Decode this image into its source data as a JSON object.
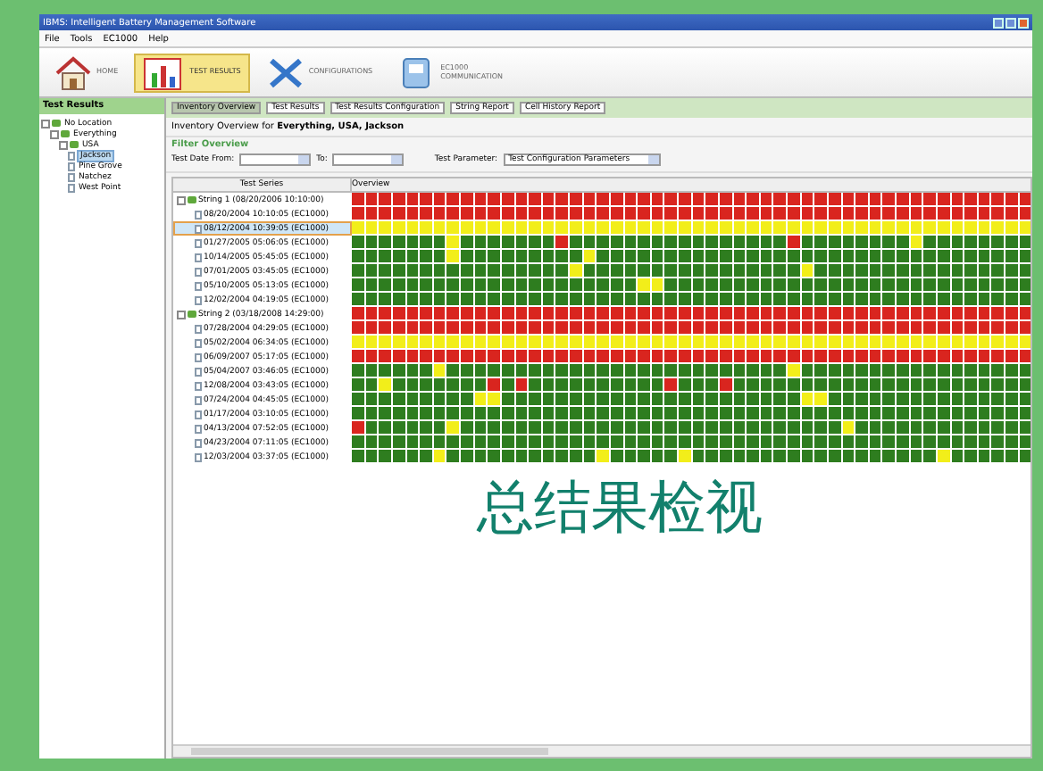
{
  "window": {
    "title": "IBMS: Intelligent Battery Management Software"
  },
  "menu": [
    "File",
    "Tools",
    "EC1000",
    "Help"
  ],
  "toolbar": [
    {
      "label": "HOME",
      "kind": "home",
      "selected": false
    },
    {
      "label": "TEST RESULTS",
      "kind": "results",
      "selected": true
    },
    {
      "label": "CONFIGURATIONS",
      "kind": "config",
      "selected": false
    },
    {
      "label": "EC1000 COMMUNICATION",
      "kind": "comm",
      "selected": false
    }
  ],
  "sidebar": {
    "title": "Test Results",
    "tree": [
      {
        "label": "No Location",
        "children": [
          {
            "label": "Everything",
            "children": [
              {
                "label": "USA",
                "children": [
                  {
                    "label": "Jackson",
                    "selected": true
                  },
                  {
                    "label": "Pine Grove",
                    "selected": false
                  },
                  {
                    "label": "Natchez",
                    "selected": false
                  },
                  {
                    "label": "West Point",
                    "selected": false
                  }
                ]
              }
            ]
          }
        ]
      }
    ]
  },
  "tabs": [
    {
      "label": "Inventory Overview",
      "selected": true
    },
    {
      "label": "Test Results",
      "selected": false
    },
    {
      "label": "Test Results Configuration",
      "selected": false
    },
    {
      "label": "String Report",
      "selected": false
    },
    {
      "label": "Cell History Report",
      "selected": false
    }
  ],
  "heading": "Inventory Overview for **Everything, USA, Jackson**",
  "filter": {
    "title": "Filter Overview",
    "date_from_label": "Test Date From:",
    "to_label": "To:",
    "parameter_label": "Test Parameter:",
    "parameter_value": "Test Configuration Parameters"
  },
  "table": {
    "columns": [
      "Test Series",
      "Overview"
    ],
    "groups": [
      {
        "label": "String 1 (08/20/2006 10:10:00)",
        "color": "#d9251f",
        "rows": [
          {
            "label": "08/20/2004 10:10:05 (EC1000)",
            "selected": false,
            "color": "#d9251f"
          },
          {
            "label": "08/12/2004 10:39:05 (EC1000)",
            "selected": true,
            "color": "#f2ee1a"
          },
          {
            "label": "01/27/2005 05:06:05 (EC1000)",
            "selected": false,
            "cells": [
              {
                "color": "#2e7d1f"
              },
              {
                "color": "#2e7d1f"
              },
              {
                "color": "#2e7d1f"
              },
              {
                "color": "#2e7d1f"
              },
              {
                "color": "#2e7d1f"
              },
              {
                "color": "#2e7d1f"
              },
              {
                "color": "#2e7d1f"
              },
              {
                "color": "#f2ee1a"
              },
              {
                "color": "#2e7d1f"
              },
              {
                "color": "#2e7d1f"
              },
              {
                "color": "#2e7d1f"
              },
              {
                "color": "#2e7d1f"
              },
              {
                "color": "#2e7d1f"
              },
              {
                "color": "#2e7d1f"
              },
              {
                "color": "#2e7d1f"
              },
              {
                "color": "#d9251f"
              },
              {
                "color": "#2e7d1f"
              },
              {
                "color": "#2e7d1f"
              },
              {
                "color": "#2e7d1f"
              },
              {
                "color": "#2e7d1f"
              },
              {
                "color": "#2e7d1f"
              },
              {
                "color": "#2e7d1f"
              },
              {
                "color": "#2e7d1f"
              },
              {
                "color": "#2e7d1f"
              },
              {
                "color": "#2e7d1f"
              },
              {
                "color": "#2e7d1f"
              },
              {
                "color": "#2e7d1f"
              },
              {
                "color": "#2e7d1f"
              },
              {
                "color": "#2e7d1f"
              },
              {
                "color": "#2e7d1f"
              },
              {
                "color": "#2e7d1f"
              },
              {
                "color": "#2e7d1f"
              },
              {
                "color": "#d9251f"
              },
              {
                "color": "#2e7d1f"
              },
              {
                "color": "#2e7d1f"
              },
              {
                "color": "#2e7d1f"
              },
              {
                "color": "#2e7d1f"
              },
              {
                "color": "#2e7d1f"
              },
              {
                "color": "#2e7d1f"
              },
              {
                "color": "#2e7d1f"
              },
              {
                "color": "#2e7d1f"
              },
              {
                "color": "#f2ee1a"
              },
              {
                "color": "#2e7d1f"
              },
              {
                "color": "#2e7d1f"
              },
              {
                "color": "#2e7d1f"
              },
              {
                "color": "#2e7d1f"
              },
              {
                "color": "#2e7d1f"
              },
              {
                "color": "#2e7d1f"
              },
              {
                "color": "#2e7d1f"
              },
              {
                "color": "#2e7d1f"
              }
            ]
          },
          {
            "label": "10/14/2005 05:45:05 (EC1000)",
            "selected": false,
            "cells": [
              {
                "color": "#2e7d1f"
              },
              {
                "color": "#2e7d1f"
              },
              {
                "color": "#2e7d1f"
              },
              {
                "color": "#2e7d1f"
              },
              {
                "color": "#2e7d1f"
              },
              {
                "color": "#2e7d1f"
              },
              {
                "color": "#2e7d1f"
              },
              {
                "color": "#f2ee1a"
              },
              {
                "color": "#2e7d1f"
              },
              {
                "color": "#2e7d1f"
              },
              {
                "color": "#2e7d1f"
              },
              {
                "color": "#2e7d1f"
              },
              {
                "color": "#2e7d1f"
              },
              {
                "color": "#2e7d1f"
              },
              {
                "color": "#2e7d1f"
              },
              {
                "color": "#2e7d1f"
              },
              {
                "color": "#2e7d1f"
              },
              {
                "color": "#f2ee1a"
              },
              {
                "color": "#2e7d1f"
              },
              {
                "color": "#2e7d1f"
              },
              {
                "color": "#2e7d1f"
              },
              {
                "color": "#2e7d1f"
              },
              {
                "color": "#2e7d1f"
              },
              {
                "color": "#2e7d1f"
              },
              {
                "color": "#2e7d1f"
              },
              {
                "color": "#2e7d1f"
              },
              {
                "color": "#2e7d1f"
              },
              {
                "color": "#2e7d1f"
              },
              {
                "color": "#2e7d1f"
              },
              {
                "color": "#2e7d1f"
              },
              {
                "color": "#2e7d1f"
              },
              {
                "color": "#2e7d1f"
              },
              {
                "color": "#2e7d1f"
              },
              {
                "color": "#2e7d1f"
              },
              {
                "color": "#2e7d1f"
              },
              {
                "color": "#2e7d1f"
              },
              {
                "color": "#2e7d1f"
              },
              {
                "color": "#2e7d1f"
              },
              {
                "color": "#2e7d1f"
              },
              {
                "color": "#2e7d1f"
              },
              {
                "color": "#2e7d1f"
              },
              {
                "color": "#2e7d1f"
              },
              {
                "color": "#2e7d1f"
              },
              {
                "color": "#2e7d1f"
              },
              {
                "color": "#2e7d1f"
              },
              {
                "color": "#2e7d1f"
              },
              {
                "color": "#2e7d1f"
              },
              {
                "color": "#2e7d1f"
              },
              {
                "color": "#2e7d1f"
              },
              {
                "color": "#2e7d1f"
              }
            ]
          },
          {
            "label": "07/01/2005 03:45:05 (EC1000)",
            "selected": false,
            "cells": [
              {
                "color": "#2e7d1f"
              },
              {
                "color": "#2e7d1f"
              },
              {
                "color": "#2e7d1f"
              },
              {
                "color": "#2e7d1f"
              },
              {
                "color": "#2e7d1f"
              },
              {
                "color": "#2e7d1f"
              },
              {
                "color": "#2e7d1f"
              },
              {
                "color": "#2e7d1f"
              },
              {
                "color": "#2e7d1f"
              },
              {
                "color": "#2e7d1f"
              },
              {
                "color": "#2e7d1f"
              },
              {
                "color": "#2e7d1f"
              },
              {
                "color": "#2e7d1f"
              },
              {
                "color": "#2e7d1f"
              },
              {
                "color": "#2e7d1f"
              },
              {
                "color": "#2e7d1f"
              },
              {
                "color": "#f2ee1a"
              },
              {
                "color": "#2e7d1f"
              },
              {
                "color": "#2e7d1f"
              },
              {
                "color": "#2e7d1f"
              },
              {
                "color": "#2e7d1f"
              },
              {
                "color": "#2e7d1f"
              },
              {
                "color": "#2e7d1f"
              },
              {
                "color": "#2e7d1f"
              },
              {
                "color": "#2e7d1f"
              },
              {
                "color": "#2e7d1f"
              },
              {
                "color": "#2e7d1f"
              },
              {
                "color": "#2e7d1f"
              },
              {
                "color": "#2e7d1f"
              },
              {
                "color": "#2e7d1f"
              },
              {
                "color": "#2e7d1f"
              },
              {
                "color": "#2e7d1f"
              },
              {
                "color": "#2e7d1f"
              },
              {
                "color": "#f2ee1a"
              },
              {
                "color": "#2e7d1f"
              },
              {
                "color": "#2e7d1f"
              },
              {
                "color": "#2e7d1f"
              },
              {
                "color": "#2e7d1f"
              },
              {
                "color": "#2e7d1f"
              },
              {
                "color": "#2e7d1f"
              },
              {
                "color": "#2e7d1f"
              },
              {
                "color": "#2e7d1f"
              },
              {
                "color": "#2e7d1f"
              },
              {
                "color": "#2e7d1f"
              },
              {
                "color": "#2e7d1f"
              },
              {
                "color": "#2e7d1f"
              },
              {
                "color": "#2e7d1f"
              },
              {
                "color": "#2e7d1f"
              },
              {
                "color": "#2e7d1f"
              },
              {
                "color": "#2e7d1f"
              }
            ]
          },
          {
            "label": "05/10/2005 05:13:05 (EC1000)",
            "selected": false,
            "cells": [
              {
                "color": "#2e7d1f"
              },
              {
                "color": "#2e7d1f"
              },
              {
                "color": "#2e7d1f"
              },
              {
                "color": "#2e7d1f"
              },
              {
                "color": "#2e7d1f"
              },
              {
                "color": "#2e7d1f"
              },
              {
                "color": "#2e7d1f"
              },
              {
                "color": "#2e7d1f"
              },
              {
                "color": "#2e7d1f"
              },
              {
                "color": "#2e7d1f"
              },
              {
                "color": "#2e7d1f"
              },
              {
                "color": "#2e7d1f"
              },
              {
                "color": "#2e7d1f"
              },
              {
                "color": "#2e7d1f"
              },
              {
                "color": "#2e7d1f"
              },
              {
                "color": "#2e7d1f"
              },
              {
                "color": "#2e7d1f"
              },
              {
                "color": "#2e7d1f"
              },
              {
                "color": "#2e7d1f"
              },
              {
                "color": "#2e7d1f"
              },
              {
                "color": "#2e7d1f"
              },
              {
                "color": "#f2ee1a"
              },
              {
                "color": "#f2ee1a"
              },
              {
                "color": "#2e7d1f"
              },
              {
                "color": "#2e7d1f"
              },
              {
                "color": "#2e7d1f"
              },
              {
                "color": "#2e7d1f"
              },
              {
                "color": "#2e7d1f"
              },
              {
                "color": "#2e7d1f"
              },
              {
                "color": "#2e7d1f"
              },
              {
                "color": "#2e7d1f"
              },
              {
                "color": "#2e7d1f"
              },
              {
                "color": "#2e7d1f"
              },
              {
                "color": "#2e7d1f"
              },
              {
                "color": "#2e7d1f"
              },
              {
                "color": "#2e7d1f"
              },
              {
                "color": "#2e7d1f"
              },
              {
                "color": "#2e7d1f"
              },
              {
                "color": "#2e7d1f"
              },
              {
                "color": "#2e7d1f"
              },
              {
                "color": "#2e7d1f"
              },
              {
                "color": "#2e7d1f"
              },
              {
                "color": "#2e7d1f"
              },
              {
                "color": "#2e7d1f"
              },
              {
                "color": "#2e7d1f"
              },
              {
                "color": "#2e7d1f"
              },
              {
                "color": "#2e7d1f"
              },
              {
                "color": "#2e7d1f"
              },
              {
                "color": "#2e7d1f"
              },
              {
                "color": "#2e7d1f"
              }
            ]
          },
          {
            "label": "12/02/2004 04:19:05 (EC1000)",
            "selected": false,
            "color": "#2e7d1f"
          }
        ]
      },
      {
        "label": "String 2 (03/18/2008 14:29:00)",
        "color": "#d9251f",
        "rows": [
          {
            "label": "07/28/2004 04:29:05 (EC1000)",
            "selected": false,
            "color": "#d9251f"
          },
          {
            "label": "05/02/2004 06:34:05 (EC1000)",
            "selected": false,
            "color": "#f2ee1a"
          },
          {
            "label": "06/09/2007 05:17:05 (EC1000)",
            "selected": false,
            "color": "#d9251f"
          },
          {
            "label": "05/04/2007 03:46:05 (EC1000)",
            "selected": false,
            "cells": [
              {
                "color": "#2e7d1f"
              },
              {
                "color": "#2e7d1f"
              },
              {
                "color": "#2e7d1f"
              },
              {
                "color": "#2e7d1f"
              },
              {
                "color": "#2e7d1f"
              },
              {
                "color": "#2e7d1f"
              },
              {
                "color": "#f2ee1a"
              },
              {
                "color": "#2e7d1f"
              },
              {
                "color": "#2e7d1f"
              },
              {
                "color": "#2e7d1f"
              },
              {
                "color": "#2e7d1f"
              },
              {
                "color": "#2e7d1f"
              },
              {
                "color": "#2e7d1f"
              },
              {
                "color": "#2e7d1f"
              },
              {
                "color": "#2e7d1f"
              },
              {
                "color": "#2e7d1f"
              },
              {
                "color": "#2e7d1f"
              },
              {
                "color": "#2e7d1f"
              },
              {
                "color": "#2e7d1f"
              },
              {
                "color": "#2e7d1f"
              },
              {
                "color": "#2e7d1f"
              },
              {
                "color": "#2e7d1f"
              },
              {
                "color": "#2e7d1f"
              },
              {
                "color": "#2e7d1f"
              },
              {
                "color": "#2e7d1f"
              },
              {
                "color": "#2e7d1f"
              },
              {
                "color": "#2e7d1f"
              },
              {
                "color": "#2e7d1f"
              },
              {
                "color": "#2e7d1f"
              },
              {
                "color": "#2e7d1f"
              },
              {
                "color": "#2e7d1f"
              },
              {
                "color": "#2e7d1f"
              },
              {
                "color": "#f2ee1a"
              },
              {
                "color": "#2e7d1f"
              },
              {
                "color": "#2e7d1f"
              },
              {
                "color": "#2e7d1f"
              },
              {
                "color": "#2e7d1f"
              },
              {
                "color": "#2e7d1f"
              },
              {
                "color": "#2e7d1f"
              },
              {
                "color": "#2e7d1f"
              },
              {
                "color": "#2e7d1f"
              },
              {
                "color": "#2e7d1f"
              },
              {
                "color": "#2e7d1f"
              },
              {
                "color": "#2e7d1f"
              },
              {
                "color": "#2e7d1f"
              },
              {
                "color": "#2e7d1f"
              },
              {
                "color": "#2e7d1f"
              },
              {
                "color": "#2e7d1f"
              },
              {
                "color": "#2e7d1f"
              },
              {
                "color": "#2e7d1f"
              }
            ]
          },
          {
            "label": "12/08/2004 03:43:05 (EC1000)",
            "selected": false,
            "cells": [
              {
                "color": "#2e7d1f"
              },
              {
                "color": "#2e7d1f"
              },
              {
                "color": "#f2ee1a"
              },
              {
                "color": "#2e7d1f"
              },
              {
                "color": "#2e7d1f"
              },
              {
                "color": "#2e7d1f"
              },
              {
                "color": "#2e7d1f"
              },
              {
                "color": "#2e7d1f"
              },
              {
                "color": "#2e7d1f"
              },
              {
                "color": "#2e7d1f"
              },
              {
                "color": "#d9251f"
              },
              {
                "color": "#2e7d1f"
              },
              {
                "color": "#d9251f"
              },
              {
                "color": "#2e7d1f"
              },
              {
                "color": "#2e7d1f"
              },
              {
                "color": "#2e7d1f"
              },
              {
                "color": "#2e7d1f"
              },
              {
                "color": "#2e7d1f"
              },
              {
                "color": "#2e7d1f"
              },
              {
                "color": "#2e7d1f"
              },
              {
                "color": "#2e7d1f"
              },
              {
                "color": "#2e7d1f"
              },
              {
                "color": "#2e7d1f"
              },
              {
                "color": "#d9251f"
              },
              {
                "color": "#2e7d1f"
              },
              {
                "color": "#2e7d1f"
              },
              {
                "color": "#2e7d1f"
              },
              {
                "color": "#d9251f"
              },
              {
                "color": "#2e7d1f"
              },
              {
                "color": "#2e7d1f"
              },
              {
                "color": "#2e7d1f"
              },
              {
                "color": "#2e7d1f"
              },
              {
                "color": "#2e7d1f"
              },
              {
                "color": "#2e7d1f"
              },
              {
                "color": "#2e7d1f"
              },
              {
                "color": "#2e7d1f"
              },
              {
                "color": "#2e7d1f"
              },
              {
                "color": "#2e7d1f"
              },
              {
                "color": "#2e7d1f"
              },
              {
                "color": "#2e7d1f"
              },
              {
                "color": "#2e7d1f"
              },
              {
                "color": "#2e7d1f"
              },
              {
                "color": "#2e7d1f"
              },
              {
                "color": "#2e7d1f"
              },
              {
                "color": "#2e7d1f"
              },
              {
                "color": "#2e7d1f"
              },
              {
                "color": "#2e7d1f"
              },
              {
                "color": "#2e7d1f"
              },
              {
                "color": "#2e7d1f"
              },
              {
                "color": "#2e7d1f"
              }
            ]
          },
          {
            "label": "07/24/2004 04:45:05 (EC1000)",
            "selected": false,
            "cells": [
              {
                "color": "#2e7d1f"
              },
              {
                "color": "#2e7d1f"
              },
              {
                "color": "#2e7d1f"
              },
              {
                "color": "#2e7d1f"
              },
              {
                "color": "#2e7d1f"
              },
              {
                "color": "#2e7d1f"
              },
              {
                "color": "#2e7d1f"
              },
              {
                "color": "#2e7d1f"
              },
              {
                "color": "#2e7d1f"
              },
              {
                "color": "#f2ee1a"
              },
              {
                "color": "#f2ee1a"
              },
              {
                "color": "#2e7d1f"
              },
              {
                "color": "#2e7d1f"
              },
              {
                "color": "#2e7d1f"
              },
              {
                "color": "#2e7d1f"
              },
              {
                "color": "#2e7d1f"
              },
              {
                "color": "#2e7d1f"
              },
              {
                "color": "#2e7d1f"
              },
              {
                "color": "#2e7d1f"
              },
              {
                "color": "#2e7d1f"
              },
              {
                "color": "#2e7d1f"
              },
              {
                "color": "#2e7d1f"
              },
              {
                "color": "#2e7d1f"
              },
              {
                "color": "#2e7d1f"
              },
              {
                "color": "#2e7d1f"
              },
              {
                "color": "#2e7d1f"
              },
              {
                "color": "#2e7d1f"
              },
              {
                "color": "#2e7d1f"
              },
              {
                "color": "#2e7d1f"
              },
              {
                "color": "#2e7d1f"
              },
              {
                "color": "#2e7d1f"
              },
              {
                "color": "#2e7d1f"
              },
              {
                "color": "#2e7d1f"
              },
              {
                "color": "#f2ee1a"
              },
              {
                "color": "#f2ee1a"
              },
              {
                "color": "#2e7d1f"
              },
              {
                "color": "#2e7d1f"
              },
              {
                "color": "#2e7d1f"
              },
              {
                "color": "#2e7d1f"
              },
              {
                "color": "#2e7d1f"
              },
              {
                "color": "#2e7d1f"
              },
              {
                "color": "#2e7d1f"
              },
              {
                "color": "#2e7d1f"
              },
              {
                "color": "#2e7d1f"
              },
              {
                "color": "#2e7d1f"
              },
              {
                "color": "#2e7d1f"
              },
              {
                "color": "#2e7d1f"
              },
              {
                "color": "#2e7d1f"
              },
              {
                "color": "#2e7d1f"
              },
              {
                "color": "#2e7d1f"
              }
            ]
          },
          {
            "label": "01/17/2004 03:10:05 (EC1000)",
            "selected": false,
            "color": "#2e7d1f"
          },
          {
            "label": "04/13/2004 07:52:05 (EC1000)",
            "selected": false,
            "cells": [
              {
                "color": "#d9251f"
              },
              {
                "color": "#2e7d1f"
              },
              {
                "color": "#2e7d1f"
              },
              {
                "color": "#2e7d1f"
              },
              {
                "color": "#2e7d1f"
              },
              {
                "color": "#2e7d1f"
              },
              {
                "color": "#2e7d1f"
              },
              {
                "color": "#f2ee1a"
              },
              {
                "color": "#2e7d1f"
              },
              {
                "color": "#2e7d1f"
              },
              {
                "color": "#2e7d1f"
              },
              {
                "color": "#2e7d1f"
              },
              {
                "color": "#2e7d1f"
              },
              {
                "color": "#2e7d1f"
              },
              {
                "color": "#2e7d1f"
              },
              {
                "color": "#2e7d1f"
              },
              {
                "color": "#2e7d1f"
              },
              {
                "color": "#2e7d1f"
              },
              {
                "color": "#2e7d1f"
              },
              {
                "color": "#2e7d1f"
              },
              {
                "color": "#2e7d1f"
              },
              {
                "color": "#2e7d1f"
              },
              {
                "color": "#2e7d1f"
              },
              {
                "color": "#2e7d1f"
              },
              {
                "color": "#2e7d1f"
              },
              {
                "color": "#2e7d1f"
              },
              {
                "color": "#2e7d1f"
              },
              {
                "color": "#2e7d1f"
              },
              {
                "color": "#2e7d1f"
              },
              {
                "color": "#2e7d1f"
              },
              {
                "color": "#2e7d1f"
              },
              {
                "color": "#2e7d1f"
              },
              {
                "color": "#2e7d1f"
              },
              {
                "color": "#2e7d1f"
              },
              {
                "color": "#2e7d1f"
              },
              {
                "color": "#2e7d1f"
              },
              {
                "color": "#f2ee1a"
              },
              {
                "color": "#2e7d1f"
              },
              {
                "color": "#2e7d1f"
              },
              {
                "color": "#2e7d1f"
              },
              {
                "color": "#2e7d1f"
              },
              {
                "color": "#2e7d1f"
              },
              {
                "color": "#2e7d1f"
              },
              {
                "color": "#2e7d1f"
              },
              {
                "color": "#2e7d1f"
              },
              {
                "color": "#2e7d1f"
              },
              {
                "color": "#2e7d1f"
              },
              {
                "color": "#2e7d1f"
              },
              {
                "color": "#2e7d1f"
              },
              {
                "color": "#2e7d1f"
              }
            ]
          },
          {
            "label": "04/23/2004 07:11:05 (EC1000)",
            "selected": false,
            "color": "#2e7d1f"
          },
          {
            "label": "12/03/2004 03:37:05 (EC1000)",
            "selected": false,
            "cells": [
              {
                "color": "#2e7d1f"
              },
              {
                "color": "#2e7d1f"
              },
              {
                "color": "#2e7d1f"
              },
              {
                "color": "#2e7d1f"
              },
              {
                "color": "#2e7d1f"
              },
              {
                "color": "#2e7d1f"
              },
              {
                "color": "#f2ee1a"
              },
              {
                "color": "#2e7d1f"
              },
              {
                "color": "#2e7d1f"
              },
              {
                "color": "#2e7d1f"
              },
              {
                "color": "#2e7d1f"
              },
              {
                "color": "#2e7d1f"
              },
              {
                "color": "#2e7d1f"
              },
              {
                "color": "#2e7d1f"
              },
              {
                "color": "#2e7d1f"
              },
              {
                "color": "#2e7d1f"
              },
              {
                "color": "#2e7d1f"
              },
              {
                "color": "#2e7d1f"
              },
              {
                "color": "#f2ee1a"
              },
              {
                "color": "#2e7d1f"
              },
              {
                "color": "#2e7d1f"
              },
              {
                "color": "#2e7d1f"
              },
              {
                "color": "#2e7d1f"
              },
              {
                "color": "#2e7d1f"
              },
              {
                "color": "#f2ee1a"
              },
              {
                "color": "#2e7d1f"
              },
              {
                "color": "#2e7d1f"
              },
              {
                "color": "#2e7d1f"
              },
              {
                "color": "#2e7d1f"
              },
              {
                "color": "#2e7d1f"
              },
              {
                "color": "#2e7d1f"
              },
              {
                "color": "#2e7d1f"
              },
              {
                "color": "#2e7d1f"
              },
              {
                "color": "#2e7d1f"
              },
              {
                "color": "#2e7d1f"
              },
              {
                "color": "#2e7d1f"
              },
              {
                "color": "#2e7d1f"
              },
              {
                "color": "#2e7d1f"
              },
              {
                "color": "#2e7d1f"
              },
              {
                "color": "#2e7d1f"
              },
              {
                "color": "#2e7d1f"
              },
              {
                "color": "#2e7d1f"
              },
              {
                "color": "#2e7d1f"
              },
              {
                "color": "#f2ee1a"
              },
              {
                "color": "#2e7d1f"
              },
              {
                "color": "#2e7d1f"
              },
              {
                "color": "#2e7d1f"
              },
              {
                "color": "#2e7d1f"
              },
              {
                "color": "#2e7d1f"
              },
              {
                "color": "#2e7d1f"
              }
            ]
          }
        ]
      }
    ]
  },
  "caption": "总结果检视"
}
